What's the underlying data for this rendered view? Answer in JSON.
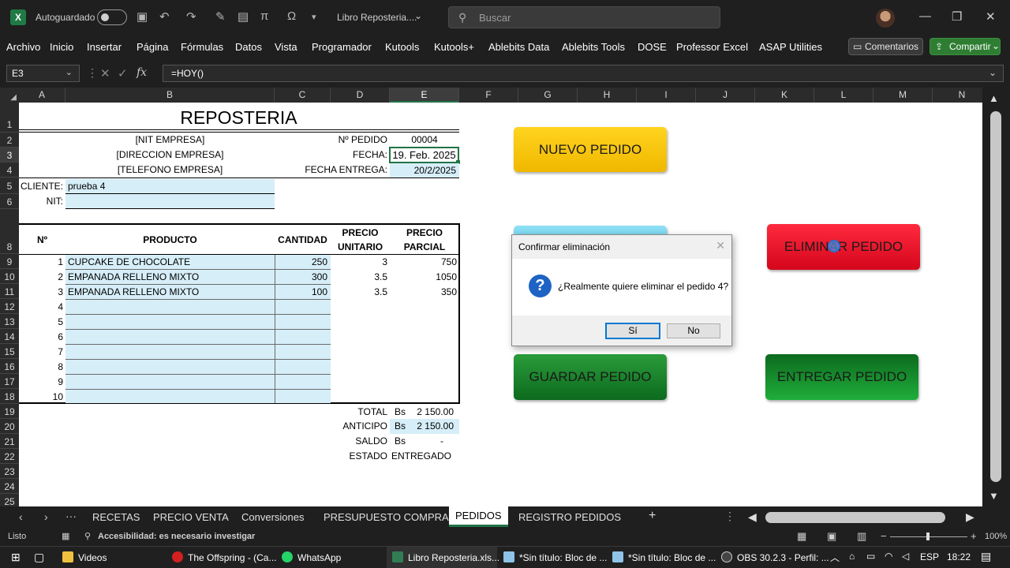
{
  "titlebar": {
    "autosave_label": "Autoguardado",
    "file_title": "Libro Reposteria....",
    "search_placeholder": "Buscar"
  },
  "menu": [
    "Archivo",
    "Inicio",
    "Insertar",
    "Página",
    "Fórmulas",
    "Datos",
    "Vista",
    "Programador",
    "Kutools",
    "Kutools+",
    "Ablebits Data",
    "Ablebits Tools",
    "DOSE",
    "Professor Excel",
    "ASAP Utilities"
  ],
  "comments_label": "Comentarios",
  "share_label": "Compartir",
  "formula": {
    "cell_ref": "E3",
    "content": "=HOY()"
  },
  "columns": [
    "A",
    "B",
    "C",
    "D",
    "E",
    "F",
    "G",
    "H",
    "I",
    "J",
    "K",
    "L",
    "M",
    "N"
  ],
  "rows": [
    "1",
    "2",
    "3",
    "4",
    "5",
    "6",
    "7",
    "8",
    "9",
    "10",
    "11",
    "12",
    "13",
    "14",
    "15",
    "16",
    "17",
    "18",
    "19",
    "20",
    "21",
    "22",
    "23",
    "24",
    "25"
  ],
  "sheet": {
    "title": "REPOSTERIA",
    "nit_empresa": "[NIT EMPRESA]",
    "direccion": "[DIRECCION EMPRESA]",
    "telefono": "[TELEFONO EMPRESA]",
    "pedido_label": "Nº PEDIDO",
    "pedido_value": "00004",
    "fecha_label": "FECHA:",
    "fecha_value": "19. Feb. 2025",
    "entrega_label": "FECHA ENTREGA:",
    "entrega_value": "20/2/2025",
    "cliente_label": "CLIENTE:",
    "cliente_value": "prueba 4",
    "nit_label": "NIT:",
    "hdr_no": "Nº",
    "hdr_producto": "PRODUCTO",
    "hdr_cantidad": "CANTIDAD",
    "hdr_precio_unitario_1": "PRECIO",
    "hdr_precio_unitario_2": "UNITARIO",
    "hdr_precio_parcial_1": "PRECIO",
    "hdr_precio_parcial_2": "PARCIAL",
    "items": [
      {
        "n": "1",
        "producto": "CUPCAKE DE CHOCOLATE",
        "cantidad": "250",
        "unitario": "3",
        "parcial": "750"
      },
      {
        "n": "2",
        "producto": "EMPANADA RELLENO MIXTO",
        "cantidad": "300",
        "unitario": "3.5",
        "parcial": "1050"
      },
      {
        "n": "3",
        "producto": "EMPANADA RELLENO MIXTO",
        "cantidad": "100",
        "unitario": "3.5",
        "parcial": "350"
      },
      {
        "n": "4",
        "producto": "",
        "cantidad": "",
        "unitario": "",
        "parcial": ""
      },
      {
        "n": "5",
        "producto": "",
        "cantidad": "",
        "unitario": "",
        "parcial": ""
      },
      {
        "n": "6",
        "producto": "",
        "cantidad": "",
        "unitario": "",
        "parcial": ""
      },
      {
        "n": "7",
        "producto": "",
        "cantidad": "",
        "unitario": "",
        "parcial": ""
      },
      {
        "n": "8",
        "producto": "",
        "cantidad": "",
        "unitario": "",
        "parcial": ""
      },
      {
        "n": "9",
        "producto": "",
        "cantidad": "",
        "unitario": "",
        "parcial": ""
      },
      {
        "n": "10",
        "producto": "",
        "cantidad": "",
        "unitario": "",
        "parcial": ""
      }
    ],
    "total_label": "TOTAL",
    "anticipo_label": "ANTICIPO",
    "saldo_label": "SALDO",
    "estado_label": "ESTADO",
    "currency": "Bs",
    "total_value": "2 150.00",
    "anticipo_value": "2 150.00",
    "saldo_value": "-",
    "estado_value": "ENTREGADO"
  },
  "buttons": {
    "nuevo": "NUEVO PEDIDO",
    "eliminar": "ELIMINAR PEDIDO",
    "guardar": "GUARDAR PEDIDO",
    "entregar": "ENTREGAR PEDIDO"
  },
  "dialog": {
    "title": "Confirmar eliminación",
    "message": "¿Realmente quiere eliminar el pedido 4?",
    "yes": "Sí",
    "no": "No"
  },
  "tabs": [
    "RECETAS",
    "PRECIO VENTA",
    "Conversiones",
    "PRESUPUESTO COMPRA",
    "PEDIDOS",
    "REGISTRO PEDIDOS"
  ],
  "active_tab": "PEDIDOS",
  "status": {
    "ready": "Listo",
    "accessibility": "Accesibilidad: es necesario investigar",
    "zoom": "100%"
  },
  "taskbar": {
    "items": [
      "Videos",
      "The Offspring - (Ca...",
      "WhatsApp",
      "Libro Reposteria.xls...",
      "*Sin título: Bloc de ...",
      "*Sin título: Bloc de ...",
      "OBS 30.2.3 - Perfil: ..."
    ],
    "lang": "ESP",
    "time": "18:22"
  },
  "colors": {
    "excel_green": "#217346",
    "cell_blue": "#d6eef8",
    "btn_yellow": "#f5c400",
    "btn_red": "#e0102a",
    "btn_green": "#1a8a2a"
  }
}
